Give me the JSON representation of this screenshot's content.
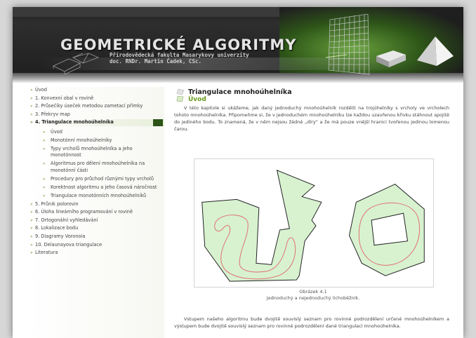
{
  "header": {
    "title": "GEOMETRICKÉ ALGORITMY",
    "subtitle_line1": "Přírodovědecká fakulta Masarykovy univerzity",
    "subtitle_line2": "doc. RNDr. Martin Čadek, CSc."
  },
  "sidebar": {
    "items": [
      {
        "label": "Úvod"
      },
      {
        "label": "1. Konvexní obal v rovině"
      },
      {
        "label": "2. Průsečíky úseček metodou zametací přímky"
      },
      {
        "label": "3. Překryv map"
      },
      {
        "label": "4. Triangulace mnohoúhelníka"
      },
      {
        "label": "5. Průnik polorovin"
      },
      {
        "label": "6. Úloha lineárního programování v rovině"
      },
      {
        "label": "7. Ortogonální vyhledávání"
      },
      {
        "label": "8. Lokalizace bodu"
      },
      {
        "label": "9. Diagramy Voronoia"
      },
      {
        "label": "10. Delaunayova triangulace"
      },
      {
        "label": "Literatura"
      }
    ],
    "subitems": [
      {
        "label": "Úvod"
      },
      {
        "label": "Monotónní mnohoúhelníky"
      },
      {
        "label": "Typy vrcholů mnohoúhelníka a jeho monotónnost"
      },
      {
        "label": "Algoritmus pro dělení mnohoúhelníka na monotónní části"
      },
      {
        "label": "Procedury pro průchod různými typy vrcholů"
      },
      {
        "label": "Korektnost algoritmu a jeho časová náročnost"
      },
      {
        "label": "Triangulace monotónních mnohoúhelníků"
      }
    ]
  },
  "main": {
    "page_title": "Triangulace mnohoúhelníka",
    "section_title": "Úvod",
    "intro": "V této kapitole si ukážeme, jak daný jednoduchý mnohoúhelník rozdělit na trojúhelníky s vrcholy ve vrcholech tohoto mnohoúhelníka. Připomeňme si, že v jednoduchém mnohoúhelníku lze každou uzavřenou křivku stáhnout spojitě do jediného bodu. To znamená, že v něm nejsou žádné „díry“ a že má pouze vnější hranici tvořenou jedinou lomenou čarou.",
    "figure_caption_1": "Obrázek 4.1",
    "figure_caption_2": "Jednoduchý a nejednoduchý lichoběžník.",
    "bottom_text": "Vstupem našeho algoritmu bude dvojitě souvislý seznam pro rovinné podrozdělení určené mnohoúhelníkem a výstupem bude dvojitě souvislý seznam pro rovinné podrozdělení dané triangulací mnohoúhelníka."
  },
  "colors": {
    "polygon_fill": "#d8f2d0",
    "polygon_stroke": "#222222",
    "curve": "#e07070",
    "section_green": "#6a9a1e",
    "active_marker": "#2c5416"
  }
}
